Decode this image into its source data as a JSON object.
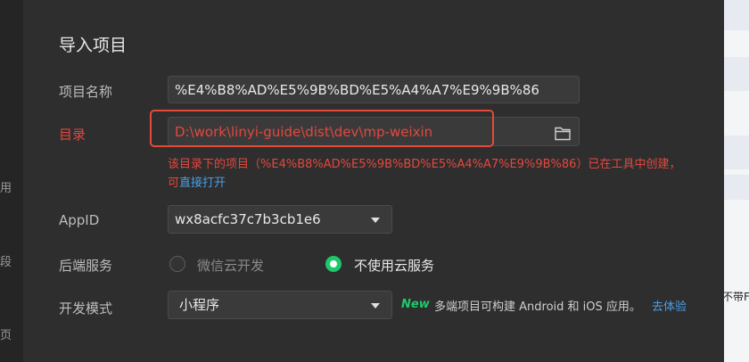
{
  "background": {
    "left_glyphs": [
      "用",
      "段",
      "页"
    ],
    "right_edge_text": "不带F"
  },
  "dialog": {
    "title": "导入项目",
    "project_name": {
      "label": "项目名称",
      "value": "%E4%B8%AD%E5%9B%BD%E5%A4%A7%E9%9B%86"
    },
    "directory": {
      "label": "目录",
      "value": "D:\\work\\linyi-guide\\dist\\dev\\mp-weixin",
      "folder_icon": "folder-icon",
      "error_line1": "该目录下的项目（%E4%B8%AD%E5%9B%BD%E5%A4%A7%E9%9B%86）已在工具中创建，",
      "error_prefix": "可",
      "error_link": "直接打开"
    },
    "appid": {
      "label": "AppID",
      "value": "wx8acfc37c7b3cb1e6"
    },
    "backend": {
      "label": "后端服务",
      "options": [
        {
          "label": "微信云开发",
          "selected": false
        },
        {
          "label": "不使用云服务",
          "selected": true
        }
      ]
    },
    "dev_mode": {
      "label": "开发模式",
      "value": "小程序",
      "badge": "New",
      "hint": "多端项目可构建 Android 和 iOS 应用。",
      "link": "去体验"
    }
  },
  "colors": {
    "error": "#e3483e",
    "accent_green": "#1ec86a",
    "link": "#4a9ee6",
    "highlight_box": "#e54a38"
  }
}
